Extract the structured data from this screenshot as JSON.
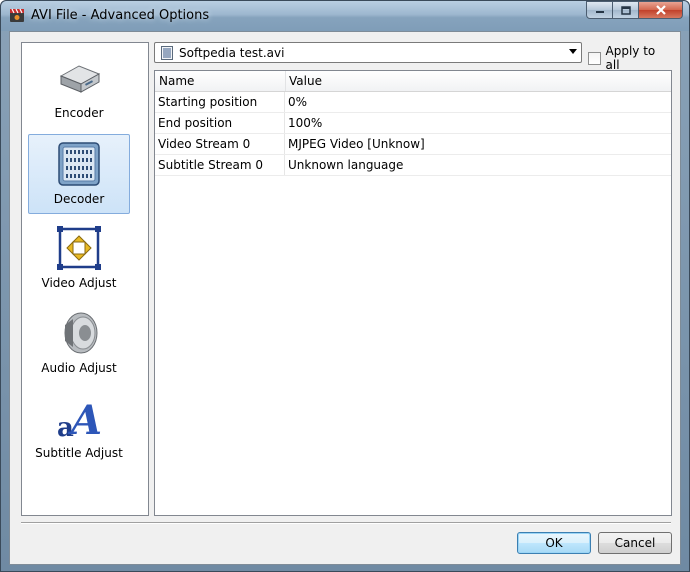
{
  "window": {
    "title": "AVI File - Advanced Options"
  },
  "sidebar": {
    "items": [
      {
        "label": "Encoder",
        "icon": "encoder-drive-icon",
        "selected": false
      },
      {
        "label": "Decoder",
        "icon": "decoder-chip-icon",
        "selected": true
      },
      {
        "label": "Video Adjust",
        "icon": "video-adjust-icon",
        "selected": false
      },
      {
        "label": "Audio Adjust",
        "icon": "speaker-icon",
        "selected": false
      },
      {
        "label": "Subtitle Adjust",
        "icon": "subtitle-text-icon",
        "selected": false
      }
    ]
  },
  "file": {
    "selected": "Softpedia test.avi",
    "icon": "file-icon"
  },
  "apply_all": {
    "label": "Apply to all",
    "checked": false
  },
  "grid": {
    "columns": [
      "Name",
      "Value"
    ],
    "rows": [
      {
        "name": "Starting position",
        "value": "0%"
      },
      {
        "name": "End position",
        "value": "100%"
      },
      {
        "name": "Video Stream 0",
        "value": "MJPEG Video [Unknow]"
      },
      {
        "name": "Subtitle Stream 0",
        "value": "Unknown language"
      }
    ]
  },
  "buttons": {
    "ok": "OK",
    "cancel": "Cancel"
  },
  "colors": {
    "selection": "#cde3f8",
    "title_bar": "#9db7cf"
  }
}
